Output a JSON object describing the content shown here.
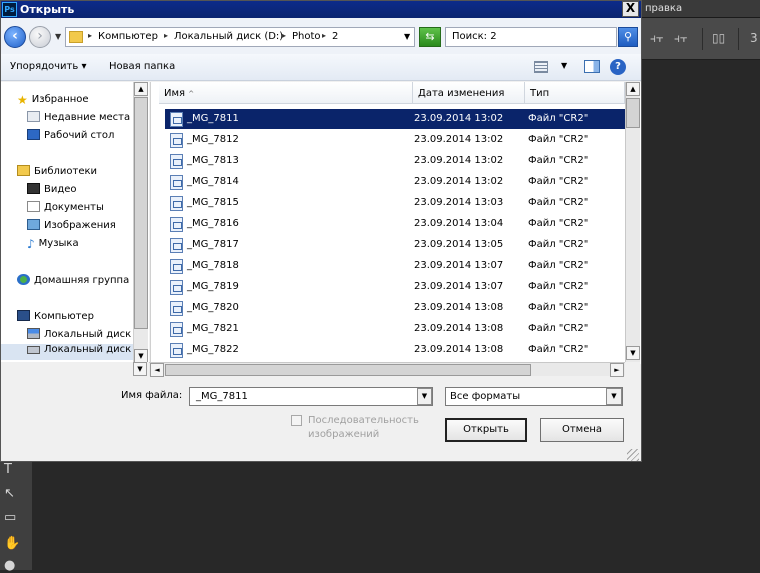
{
  "app": {
    "menu_label": "правка",
    "tools": [
      "T",
      "↖",
      "▭",
      "✋",
      "●"
    ]
  },
  "dialog": {
    "title": "Открыть",
    "close_glyph": "X",
    "breadcrumb": [
      "Компьютер",
      "Локальный диск (D:)",
      "Photo",
      "2"
    ],
    "search_placeholder": "Поиск: 2",
    "commands": {
      "organize": "Упорядочить ▾",
      "new_folder": "Новая папка"
    },
    "nav": {
      "favorites": "Избранное",
      "recent": "Недавние места",
      "desktop": "Рабочий стол",
      "libraries": "Библиотеки",
      "video": "Видео",
      "documents": "Документы",
      "images": "Изображения",
      "music": "Музыка",
      "homegroup": "Домашняя группа",
      "computer": "Компьютер",
      "disk1": "Локальный диск (",
      "disk2": "Локальный диск ("
    },
    "columns": {
      "name": "Имя",
      "date": "Дата изменения",
      "type": "Тип"
    },
    "files": [
      {
        "name": "_MG_7811",
        "date": "23.09.2014 13:02",
        "type": "Файл \"CR2\""
      },
      {
        "name": "_MG_7812",
        "date": "23.09.2014 13:02",
        "type": "Файл \"CR2\""
      },
      {
        "name": "_MG_7813",
        "date": "23.09.2014 13:02",
        "type": "Файл \"CR2\""
      },
      {
        "name": "_MG_7814",
        "date": "23.09.2014 13:02",
        "type": "Файл \"CR2\""
      },
      {
        "name": "_MG_7815",
        "date": "23.09.2014 13:03",
        "type": "Файл \"CR2\""
      },
      {
        "name": "_MG_7816",
        "date": "23.09.2014 13:04",
        "type": "Файл \"CR2\""
      },
      {
        "name": "_MG_7817",
        "date": "23.09.2014 13:05",
        "type": "Файл \"CR2\""
      },
      {
        "name": "_MG_7818",
        "date": "23.09.2014 13:07",
        "type": "Файл \"CR2\""
      },
      {
        "name": "_MG_7819",
        "date": "23.09.2014 13:07",
        "type": "Файл \"CR2\""
      },
      {
        "name": "_MG_7820",
        "date": "23.09.2014 13:08",
        "type": "Файл \"CR2\""
      },
      {
        "name": "_MG_7821",
        "date": "23.09.2014 13:08",
        "type": "Файл \"CR2\""
      },
      {
        "name": "_MG_7822",
        "date": "23.09.2014 13:08",
        "type": "Файл \"CR2\""
      }
    ],
    "filename_label": "Имя файла:",
    "filename_value": "_MG_7811",
    "filetype_value": "Все форматы",
    "sequence_label": "Последовательность изображений",
    "open_label": "Открыть",
    "cancel_label": "Отмена"
  }
}
